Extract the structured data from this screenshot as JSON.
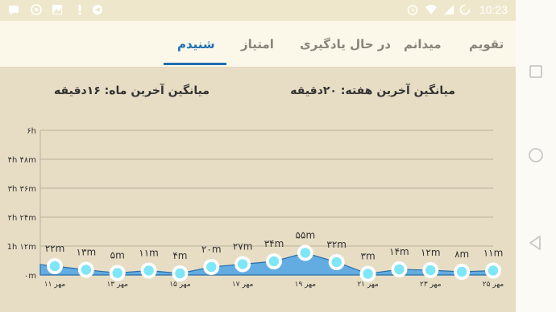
{
  "status_bar": {
    "time": "10:23",
    "icons": [
      "message-icon",
      "whatsapp-icon",
      "gallery-icon",
      "exclamation-icon",
      "telegram-icon",
      "alarm-icon",
      "wifi-icon",
      "signal-icon",
      "battery-icon"
    ]
  },
  "tabs": [
    {
      "label": "تقویم",
      "active": false
    },
    {
      "label": "میدانم",
      "active": false
    },
    {
      "label": "در حال یادگیری",
      "active": false
    },
    {
      "label": "امتیاز",
      "active": false
    },
    {
      "label": "شنیدم",
      "active": true
    }
  ],
  "stats": {
    "week_avg": "میانگین آخرین هفته: ۲۰دقیقه",
    "month_avg": "میانگین آخرین ماه: ۱۶دقیقه"
  },
  "colors": {
    "accent": "#1e6fb2",
    "area_fill": "#4aa3e8",
    "point_fill": "#7ee6f7",
    "tab_bg": "#fbf8ea",
    "content_bg": "#e7ddc4"
  },
  "nav_bar": {
    "icons": [
      "recent-apps-icon",
      "home-icon",
      "back-icon"
    ]
  },
  "chart_data": {
    "type": "area",
    "y_ticks": [
      "۰m",
      "1h ۱۲m",
      "۲h ۲۴m",
      "۳h ۳۶m",
      "۴h ۴۸m",
      "۶h"
    ],
    "ylim": [
      0,
      360
    ],
    "grid": true,
    "x": [
      "۱۱ مهر",
      "۱۲ مهر",
      "۱۳ مهر",
      "۱۴ مهر",
      "۱۵ مهر",
      "۱۶ مهر",
      "۱۷ مهر",
      "۱۸ مهر",
      "۱۹ مهر",
      "۲۰ مهر",
      "۲۱ مهر",
      "۲۲ مهر",
      "۲۳ مهر",
      "۲۴ مهر",
      "۲۵ مهر"
    ],
    "x_tick_labels": [
      "۱۱ مهر",
      "",
      "۱۳ مهر",
      "",
      "۱۵ مهر",
      "",
      "۱۷ مهر",
      "",
      "۱۹ مهر",
      "",
      "۲۱ مهر",
      "",
      "۲۳ مهر",
      "",
      "۲۵ مهر"
    ],
    "values": [
      22,
      13,
      5,
      11,
      4,
      20,
      27,
      34,
      55,
      32,
      3,
      14,
      12,
      8,
      11
    ],
    "data_labels": [
      "۲۲m",
      "۱۳m",
      "۵m",
      "۱۱m",
      "۴m",
      "۲۰m",
      "۲۷m",
      "۳۴m",
      "۵۵m",
      "۳۲m",
      "۳m",
      "۱۴m",
      "۱۲m",
      "۸m",
      "۱۱m"
    ]
  }
}
